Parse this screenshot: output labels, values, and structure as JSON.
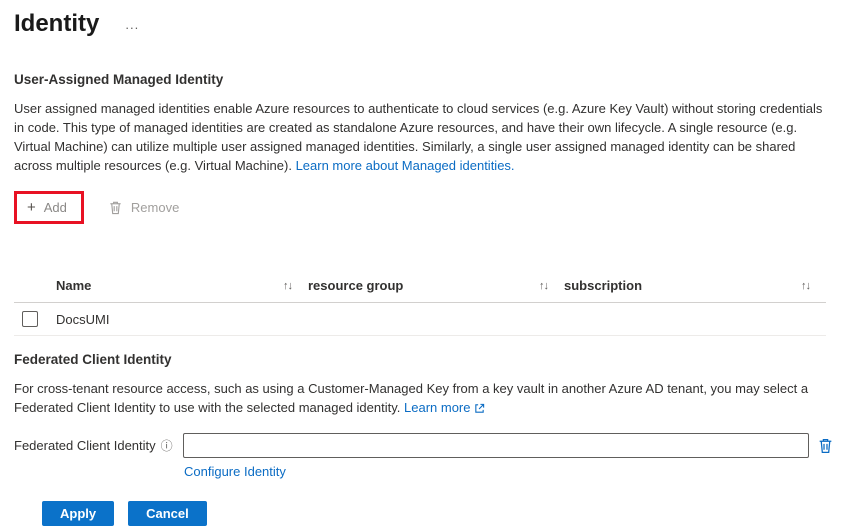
{
  "page": {
    "title": "Identity",
    "ellipsis": "..."
  },
  "icons": {
    "plus": "+",
    "sort": "↑↓",
    "info": "ⓘ"
  },
  "uami": {
    "heading": "User-Assigned Managed Identity",
    "description": "User assigned managed identities enable Azure resources to authenticate to cloud services (e.g. Azure Key Vault) without storing credentials in code. This type of managed identities are created as standalone Azure resources, and have their own lifecycle. A single resource (e.g. Virtual Machine) can utilize multiple user assigned managed identities. Similarly, a single user assigned managed identity can be shared across multiple resources (e.g. Virtual Machine).",
    "learn_more": "Learn more about Managed identities.",
    "toolbar": {
      "add": "Add",
      "remove": "Remove"
    },
    "table": {
      "columns": [
        "Name",
        "resource group",
        "subscription"
      ],
      "rows": [
        {
          "name": "DocsUMI"
        }
      ]
    }
  },
  "fci": {
    "heading": "Federated Client Identity",
    "description": "For cross-tenant resource access, such as using a Customer-Managed Key from a key vault in another Azure AD tenant, you may select a Federated Client Identity to use with the selected managed identity.",
    "learn_more": "Learn more",
    "field_label": "Federated Client Identity",
    "input_value": "",
    "configure_link": "Configure Identity"
  },
  "footer": {
    "apply": "Apply",
    "cancel": "Cancel"
  },
  "colors": {
    "link": "#0b6cc4",
    "primary_button": "#0b72c9",
    "highlight_border": "#e81123"
  }
}
